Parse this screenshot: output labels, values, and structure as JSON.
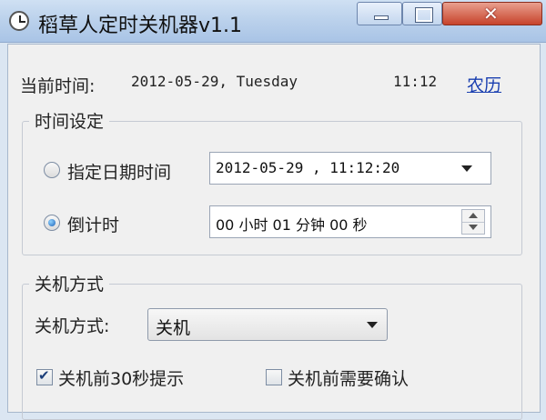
{
  "window": {
    "title": "稻草人定时关机器v1.1",
    "minimize_icon": "minimize-icon",
    "maximize_icon": "maximize-icon",
    "close_icon": "close-icon"
  },
  "current": {
    "label": "当前时间:",
    "date": "2012-05-29, Tuesday",
    "time": "11:12",
    "lunar_link": "农历"
  },
  "time_setting": {
    "group_title": "时间设定",
    "option_specific": "指定日期时间",
    "specific_value": "2012-05-29 , 11:12:20",
    "option_countdown": "倒计时",
    "countdown_value": "00 小时 01 分钟 00 秒",
    "selected": "countdown"
  },
  "shutdown": {
    "group_title": "关机方式",
    "mode_label": "关机方式:",
    "mode_value": "关机",
    "prompt_label": "关机前30秒提示",
    "prompt_checked": true,
    "confirm_label": "关机前需要确认",
    "confirm_checked": false
  },
  "colors": {
    "link": "#1a3fb0",
    "close_button": "#c7432b",
    "titlebar": "#bcd2ec"
  }
}
